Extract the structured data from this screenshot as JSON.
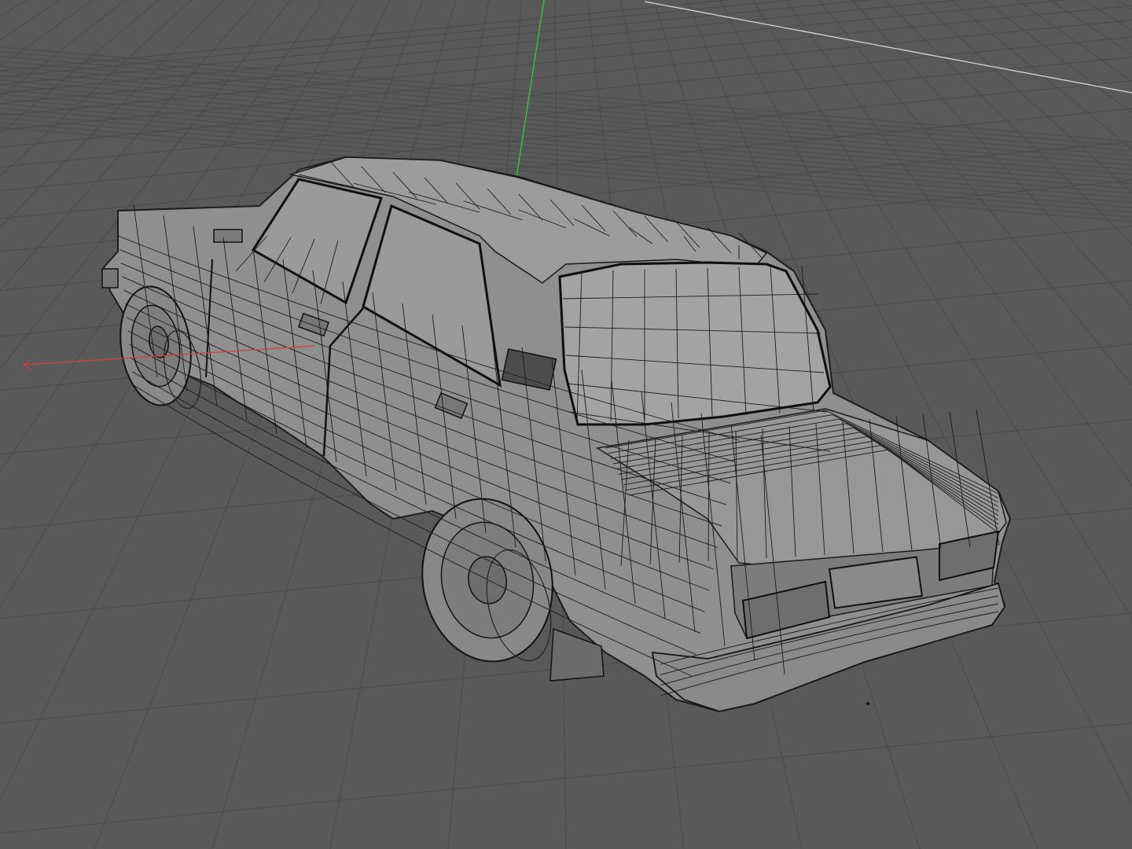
{
  "viewport": {
    "view": "perspective",
    "shading": "wireframe-on-shaded",
    "background_color": "#595959"
  },
  "colors": {
    "grid_line": "#4a4a4a",
    "grid_horizon": "#3f3f3f",
    "x_axis": "#c0392b",
    "y_axis": "#27ae60",
    "model_fill": "#8c8c8c",
    "model_light": "#a9a9a9",
    "model_dark": "#6a6a6a",
    "wire": "#1a1a1a",
    "highlight": "#ffffff"
  },
  "icons": {
    "x_axis": "x-axis-arrow-icon",
    "y_axis": "y-axis-line-icon"
  },
  "scene": {
    "object": "sedan-wireframe-model",
    "grid_visible": true,
    "axes_visible": true
  }
}
